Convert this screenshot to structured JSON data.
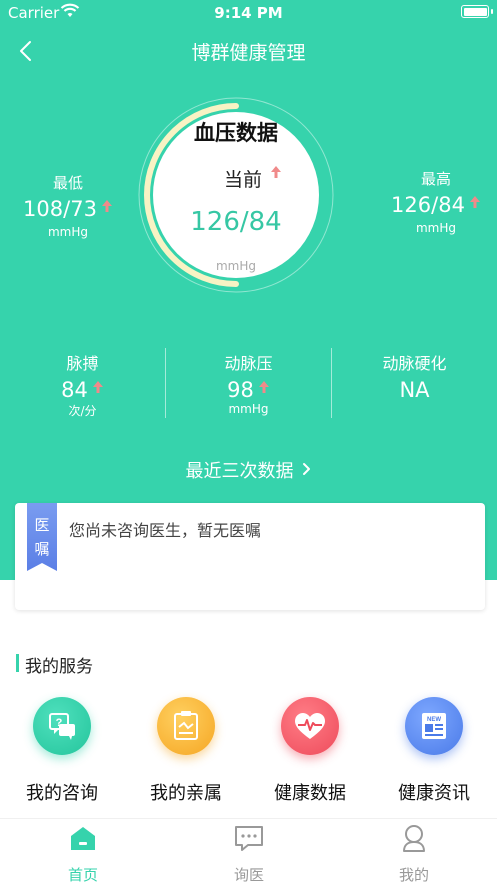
{
  "status_bar": {
    "carrier": "Carrier",
    "time": "9:14 PM"
  },
  "nav": {
    "title": "博群健康管理"
  },
  "gauge": {
    "title": "血压数据",
    "current_label": "当前",
    "value": "126/84",
    "unit": "mmHg",
    "progress": 0.5
  },
  "low": {
    "label": "最低",
    "value": "108/73",
    "unit": "mmHg"
  },
  "high": {
    "label": "最高",
    "value": "126/84",
    "unit": "mmHg"
  },
  "metrics": [
    {
      "label": "脉搏",
      "value": "84",
      "unit": "次/分"
    },
    {
      "label": "动脉压",
      "value": "98",
      "unit": "mmHg"
    },
    {
      "label": "动脉硬化",
      "value": "NA",
      "unit": ""
    }
  ],
  "recent_link": "最近三次数据",
  "advice": {
    "ribbon": "医\n嘱",
    "ribbon_1": "医",
    "ribbon_2": "嘱",
    "text": "您尚未咨询医生，暂无医嘱"
  },
  "services_title": "我的服务",
  "services": [
    {
      "label": "我的咨询",
      "icon": "consult-icon",
      "color": "#36d3ac"
    },
    {
      "label": "我的亲属",
      "icon": "relatives-icon",
      "color": "#f7b733"
    },
    {
      "label": "健康数据",
      "icon": "health-data-icon",
      "color": "#f25c6a"
    },
    {
      "label": "健康资讯",
      "icon": "news-icon",
      "color": "#5b8def"
    }
  ],
  "tabs": [
    {
      "label": "首页",
      "icon": "home-icon",
      "active": true
    },
    {
      "label": "询医",
      "icon": "chat-icon",
      "active": false
    },
    {
      "label": "我的",
      "icon": "profile-icon",
      "active": false
    }
  ],
  "colors": {
    "primary": "#36d3ac",
    "up_arrow": "#f08a8a",
    "gauge_arc": "#f8f3c4"
  }
}
